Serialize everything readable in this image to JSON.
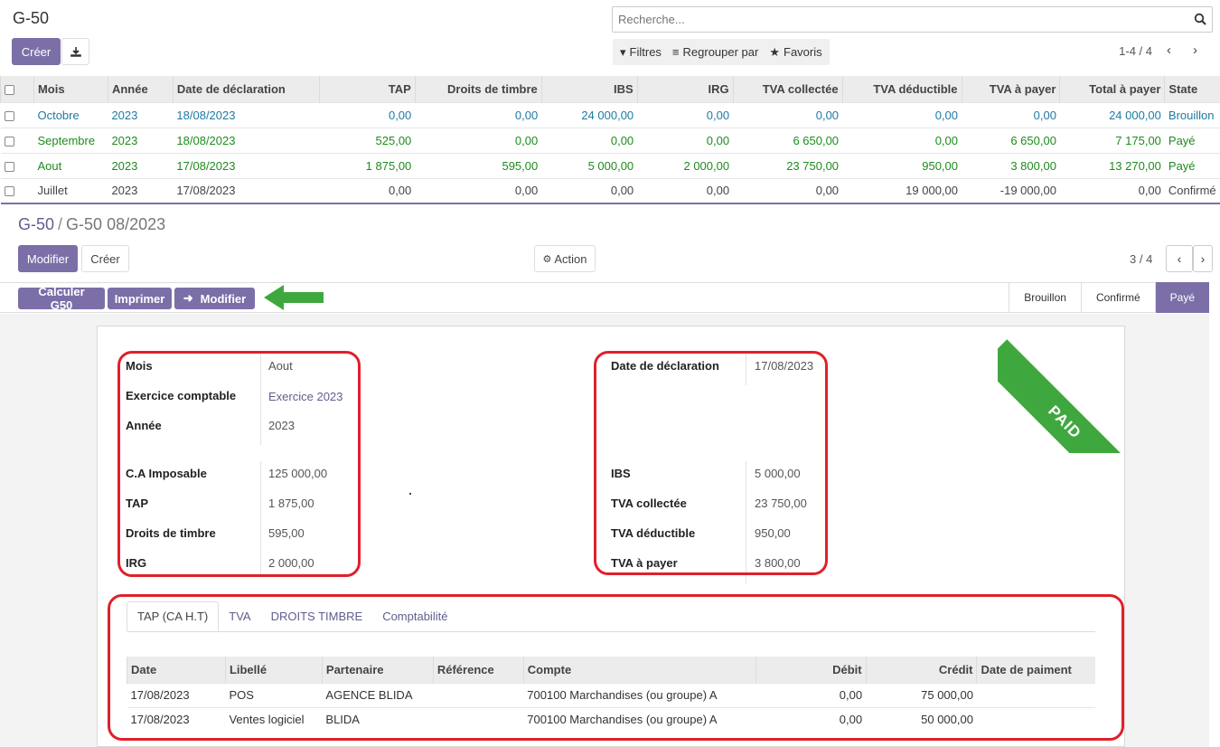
{
  "list": {
    "title": "G-50",
    "create_label": "Créer",
    "search_placeholder": "Recherche...",
    "filters_label": "Filtres",
    "group_label": "Regrouper par",
    "favorites_label": "Favoris",
    "pager": "1-4 / 4",
    "columns": [
      "Mois",
      "Année",
      "Date de déclaration",
      "TAP",
      "Droits de timbre",
      "IBS",
      "IRG",
      "TVA collectée",
      "TVA déductible",
      "TVA à payer",
      "Total à payer",
      "State"
    ],
    "rows": [
      [
        "Octobre",
        "2023",
        "18/08/2023",
        "0,00",
        "0,00",
        "24 000,00",
        "0,00",
        "0,00",
        "0,00",
        "0,00",
        "24 000,00",
        "Brouillon"
      ],
      [
        "Septembre",
        "2023",
        "18/08/2023",
        "525,00",
        "0,00",
        "0,00",
        "0,00",
        "6 650,00",
        "0,00",
        "6 650,00",
        "7 175,00",
        "Payé"
      ],
      [
        "Aout",
        "2023",
        "17/08/2023",
        "1 875,00",
        "595,00",
        "5 000,00",
        "2 000,00",
        "23 750,00",
        "950,00",
        "3 800,00",
        "13 270,00",
        "Payé"
      ],
      [
        "Juillet",
        "2023",
        "17/08/2023",
        "0,00",
        "0,00",
        "0,00",
        "0,00",
        "0,00",
        "19 000,00",
        "-19 000,00",
        "0,00",
        "Confirmé"
      ]
    ],
    "row_colors": [
      "#1f7aa3",
      "#1e8b1e",
      "#1e8b1e",
      "#444444"
    ]
  },
  "form": {
    "breadcrumb_parent": "G-50",
    "breadcrumb_current": "G-50 08/2023",
    "modify_label": "Modifier",
    "create_label": "Créer",
    "action_label": "Action",
    "pager": "3 / 4",
    "buttons": [
      "Calculer G50",
      "Imprimer",
      "Modifier"
    ],
    "stages": [
      "Brouillon",
      "Confirmé",
      "Payé"
    ],
    "ribbon": "PAID",
    "left_fields": [
      {
        "label": "Mois",
        "value": "Aout"
      },
      {
        "label": "Exercice comptable",
        "value": "Exercice 2023"
      },
      {
        "label": "Année",
        "value": "2023"
      },
      {
        "label": "C.A Imposable",
        "value": "125 000,00"
      },
      {
        "label": "TAP",
        "value": "1 875,00"
      },
      {
        "label": "Droits de timbre",
        "value": "595,00"
      },
      {
        "label": "IRG",
        "value": "2 000,00"
      }
    ],
    "right_fields": [
      {
        "label": "Date de déclaration",
        "value": "17/08/2023"
      },
      {
        "label": "IBS",
        "value": "5 000,00"
      },
      {
        "label": "TVA collectée",
        "value": "23 750,00"
      },
      {
        "label": "TVA déductible",
        "value": "950,00"
      },
      {
        "label": "TVA à payer",
        "value": "3 800,00"
      }
    ],
    "tabs": [
      "TAP (CA H.T)",
      "TVA",
      "DROITS TIMBRE",
      "Comptabilité"
    ],
    "line_columns": [
      "Date",
      "Libellé",
      "Partenaire",
      "Référence",
      "Compte",
      "Débit",
      "Crédit",
      "Date de paiment"
    ],
    "lines": [
      [
        "17/08/2023",
        "POS",
        "AGENCE BLIDA",
        "",
        "700100 Marchandises (ou groupe) A",
        "0,00",
        "75 000,00",
        ""
      ],
      [
        "17/08/2023",
        "Ventes logiciel",
        "BLIDA",
        "",
        "700100 Marchandises (ou groupe) A",
        "0,00",
        "50 000,00",
        ""
      ]
    ]
  },
  "colors": {
    "primary": "#7c6fa8",
    "annotation_red": "#e0202a",
    "annotation_green": "#3ea83e"
  }
}
